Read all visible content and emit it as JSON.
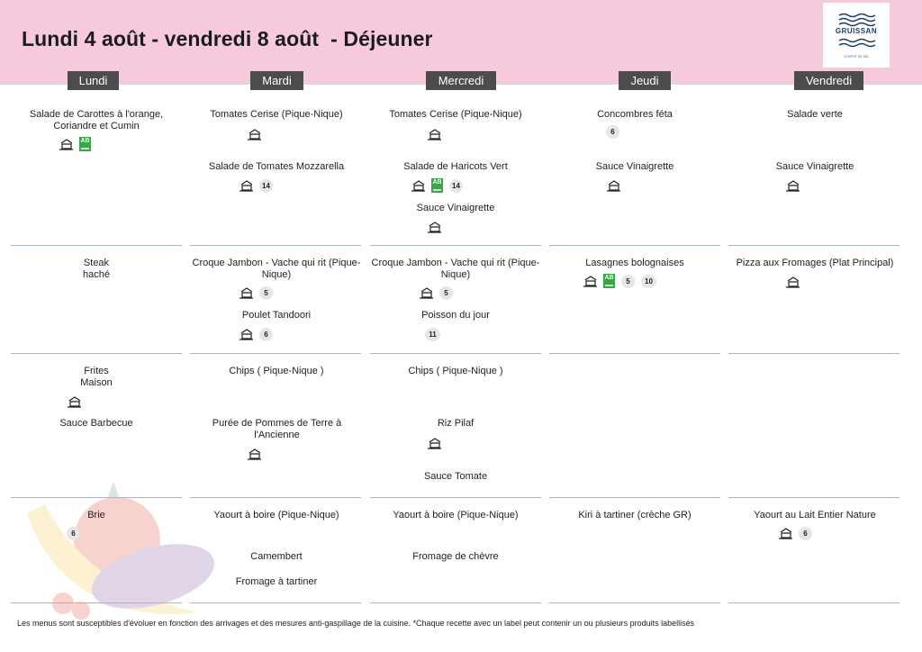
{
  "title": "Lundi 4 août - vendredi 8 août  - Déjeuner",
  "logo": {
    "name": "GRUISSAN",
    "tagline": "L'ESPRIT DE SEL"
  },
  "days": [
    "Lundi",
    "Mardi",
    "Mercredi",
    "Jeudi",
    "Vendredi"
  ],
  "menu": {
    "entrees": {
      "lundi": [
        {
          "name": "Salade de Carottes à l'orange, Coriandre et Cumin"
        }
      ],
      "mardi": [
        {
          "name": "Tomates Cerise (Pique-Nique)"
        },
        {
          "name": "Salade de Tomates Mozzarella",
          "badge": "14"
        }
      ],
      "mercredi": [
        {
          "name": "Tomates Cerise (Pique-Nique)"
        },
        {
          "name": "Salade de Haricots Vert",
          "badge": "14"
        },
        {
          "name": "Sauce Vinaigrette"
        }
      ],
      "jeudi": [
        {
          "name": "Concombres féta",
          "badge": "6"
        },
        {
          "name": "Sauce Vinaigrette"
        }
      ],
      "vendredi": [
        {
          "name": "Salade verte"
        },
        {
          "name": "Sauce Vinaigrette"
        }
      ]
    },
    "plats": {
      "lundi": [
        {
          "name": "Steak haché"
        }
      ],
      "mardi": [
        {
          "name": "Croque Jambon - Vache qui rit (Pique-Nique)",
          "badge": "5"
        },
        {
          "name": "Poulet Tandoori",
          "badge": "6"
        }
      ],
      "mercredi": [
        {
          "name": "Croque Jambon - Vache qui rit (Pique-Nique)",
          "badge": "5"
        },
        {
          "name": "Poisson du jour",
          "badge": "11"
        }
      ],
      "jeudi": [
        {
          "name": "Lasagnes bolognaises",
          "badges": [
            "5",
            "10"
          ]
        }
      ],
      "vendredi": [
        {
          "name": "Pizza aux Fromages  (Plat Principal)"
        }
      ]
    },
    "accompagnements": {
      "lundi": [
        {
          "name": "Frites Maison"
        },
        {
          "name": "Sauce Barbecue"
        }
      ],
      "mardi": [
        {
          "name": "Chips ( Pique-Nique )"
        },
        {
          "name": "Purée de Pommes de Terre à l'Ancienne"
        }
      ],
      "mercredi": [
        {
          "name": "Chips ( Pique-Nique )"
        },
        {
          "name": "Riz Pilaf"
        },
        {
          "name": "Sauce Tomate"
        }
      ]
    },
    "desserts": {
      "lundi": [
        {
          "name": "Brie",
          "badge": "6"
        }
      ],
      "mardi": [
        {
          "name": "Yaourt à boire (Pique-Nique)"
        },
        {
          "name": "Camembert"
        },
        {
          "name": "Fromage à tartiner"
        }
      ],
      "mercredi": [
        {
          "name": "Yaourt à boire (Pique-Nique)"
        },
        {
          "name": "Fromage de chèvre"
        }
      ],
      "jeudi": [
        {
          "name": "Kiri à tartiner (crèche GR)"
        }
      ],
      "vendredi": [
        {
          "name": "Yaourt au Lait Entier Nature",
          "badge": "6"
        }
      ]
    }
  },
  "labels": {
    "ab": "AB"
  },
  "footer": "Les menus sont susceptibles d'évoluer en fonction des arrivages et des mesures anti-gaspillage de la cuisine. *Chaque recette avec un label peut contenir un ou plusieurs produits labellisés",
  "colors": {
    "header": "#f7c9dd",
    "dayLabel": "#4c4c4c",
    "separator": "#a9b5c1",
    "ab": "#3aa647"
  }
}
